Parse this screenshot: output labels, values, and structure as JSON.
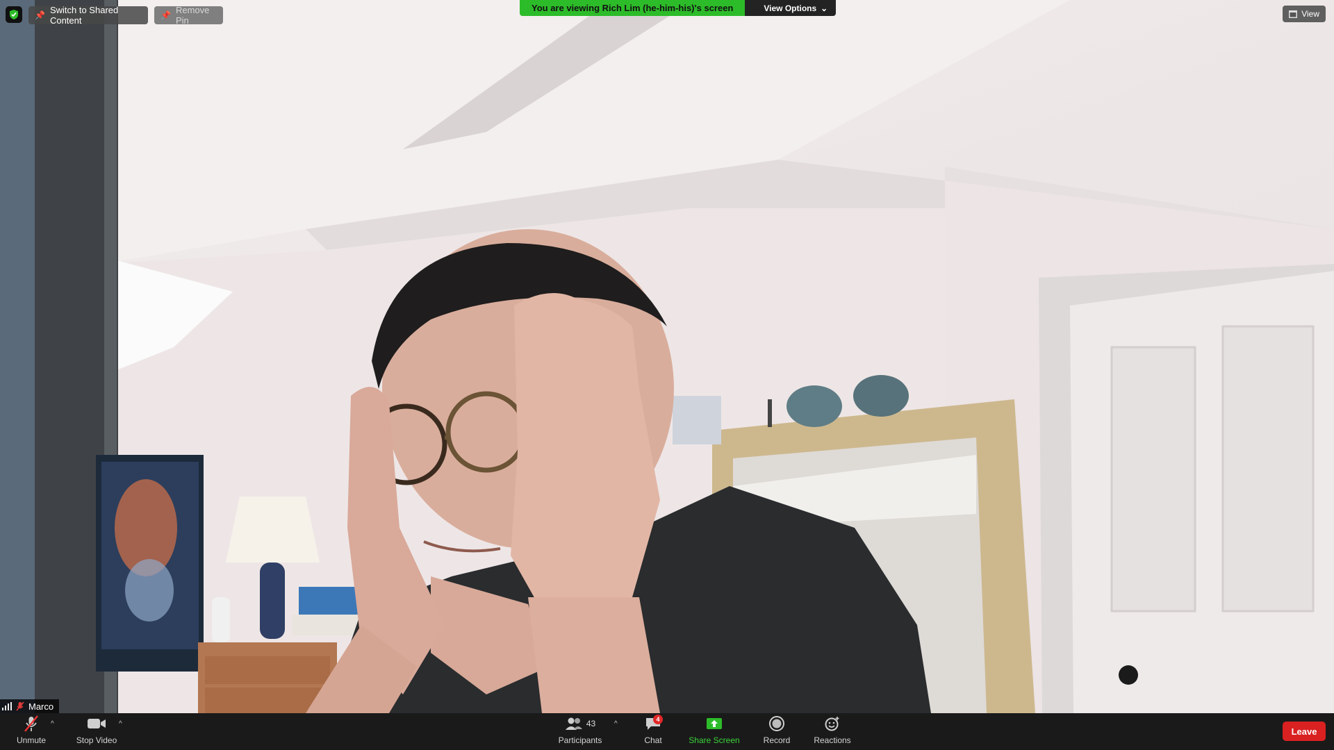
{
  "top": {
    "security_icon": "shield-check-icon",
    "switch_label": "Switch to Shared Content",
    "remove_pin_label": "Remove Pin",
    "banner_text": "You are viewing Rich Lim  (he-him-his)'s screen",
    "view_options_label": "View Options",
    "view_label": "View"
  },
  "participant": {
    "name": "Marco",
    "muted": true
  },
  "toolbar": {
    "unmute_label": "Unmute",
    "stop_video_label": "Stop Video",
    "participants_label": "Participants",
    "participants_count": "43",
    "chat_label": "Chat",
    "chat_badge": "4",
    "share_label": "Share Screen",
    "record_label": "Record",
    "reactions_label": "Reactions",
    "leave_label": "Leave"
  },
  "colors": {
    "banner_green": "#2dbc29",
    "share_green": "#3bd43a",
    "leave_red": "#d92121",
    "toolbar_bg": "#1a1a1a"
  }
}
